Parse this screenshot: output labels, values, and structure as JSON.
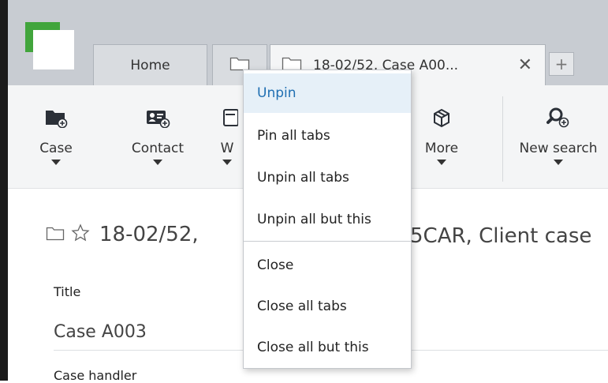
{
  "colors": {
    "logo_green": "#41a53c",
    "title_bar": "#c8ccd2",
    "menu_highlight_bg": "#e6f0f8",
    "menu_highlight_text": "#1f6fb2",
    "icon_dark": "#2b3038"
  },
  "tabs": [
    {
      "label": "Home"
    },
    {
      "label": "",
      "icon": "folder-icon"
    },
    {
      "label": "18-02/52, Case A00...",
      "icon": "folder-icon",
      "close": "✕"
    }
  ],
  "new_tab_label": "+",
  "ribbon": {
    "buttons": [
      {
        "label": "Case",
        "icon": "new-case-icon"
      },
      {
        "label": "Contact",
        "icon": "new-contact-icon"
      },
      {
        "label": "W",
        "icon": "new-document-icon"
      },
      {
        "label": "More",
        "icon": "box-icon"
      },
      {
        "label": "New search",
        "icon": "new-search-icon"
      }
    ]
  },
  "record": {
    "title_left": "18-02/52,",
    "title_right": "5CAR, Client case",
    "fields": [
      {
        "label": "Title",
        "value": "Case A003"
      },
      {
        "label": "Case handler"
      }
    ]
  },
  "context_menu": {
    "items": [
      {
        "label": "Unpin",
        "highlighted": true
      },
      {
        "label": "Pin all tabs"
      },
      {
        "label": "Unpin all tabs"
      },
      {
        "label": "Unpin all but this"
      },
      {
        "label": "Close"
      },
      {
        "label": "Close all tabs"
      },
      {
        "label": "Close all but this"
      }
    ]
  }
}
